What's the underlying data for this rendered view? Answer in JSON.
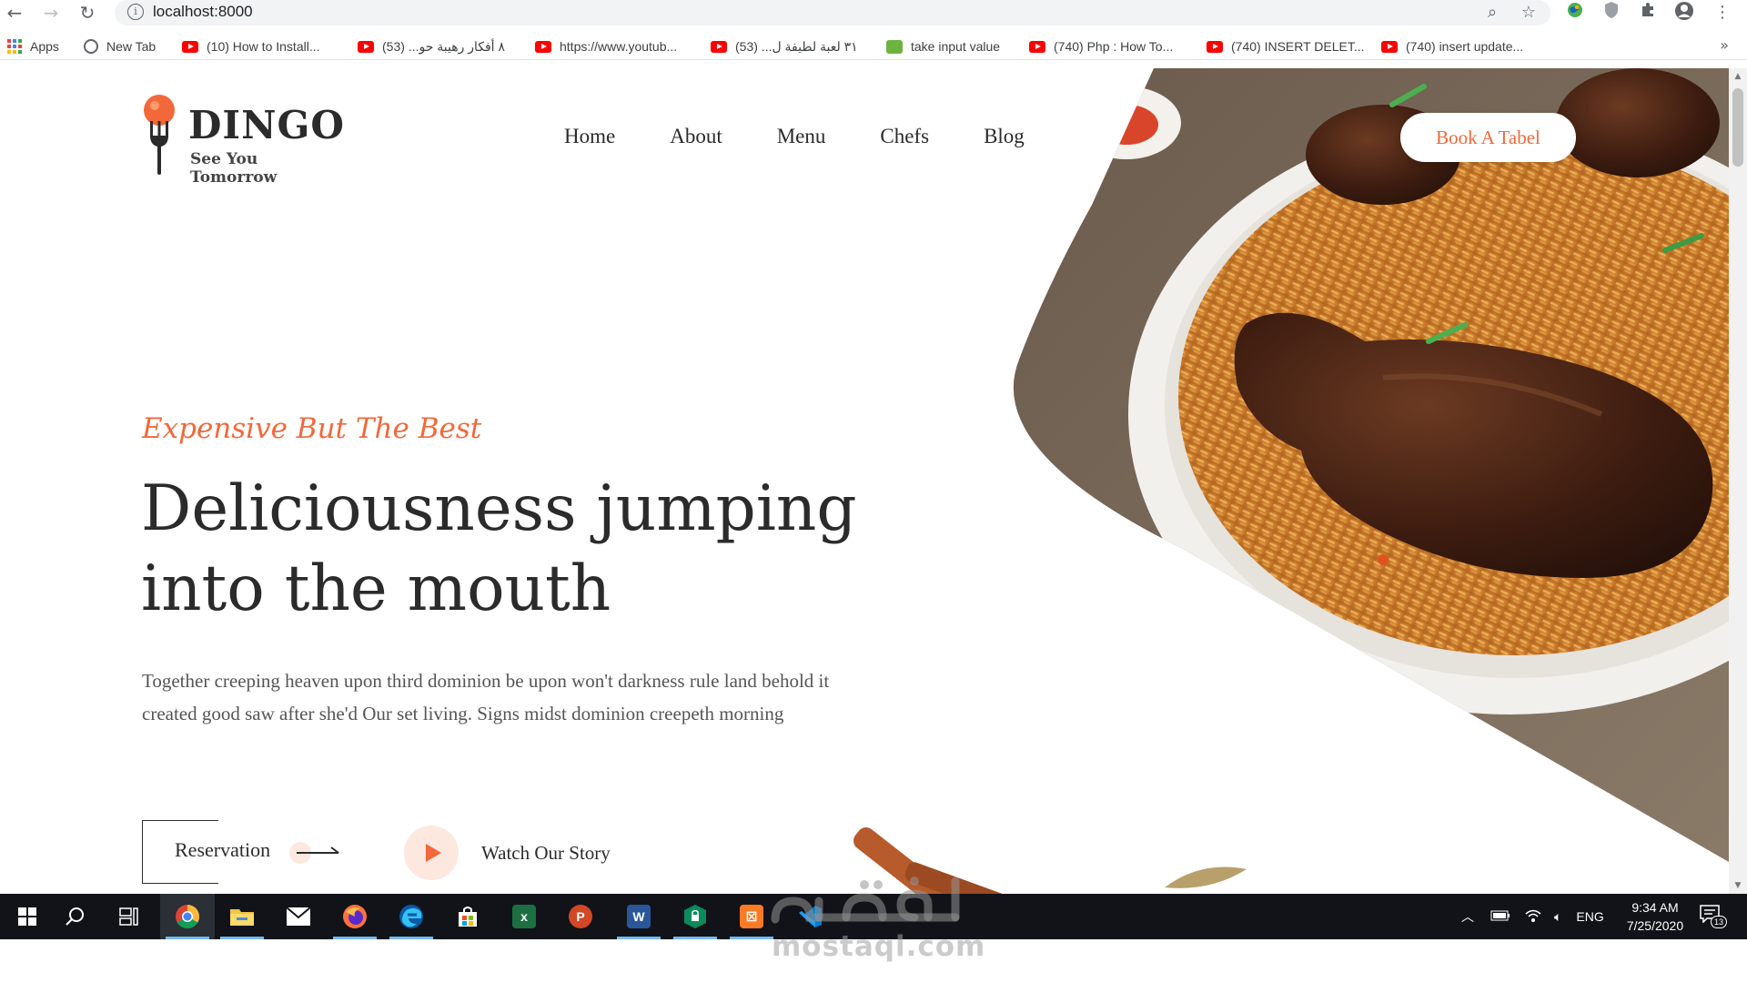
{
  "browser": {
    "url": "localhost:8000",
    "bookmarks": [
      {
        "label": "Apps",
        "icon": "apps-grid-icon"
      },
      {
        "label": "New Tab",
        "icon": "globe-icon"
      },
      {
        "label": "(10) How to Install...",
        "icon": "youtube-icon"
      },
      {
        "label": "٨ أفكار رهيبة حو... (53)",
        "icon": "youtube-icon"
      },
      {
        "label": "https://www.youtub...",
        "icon": "youtube-icon"
      },
      {
        "label": "٣١ لعبة لطيفة ل... (53)",
        "icon": "youtube-icon"
      },
      {
        "label": "take input value",
        "icon": "code-icon"
      },
      {
        "label": "(740) Php : How To...",
        "icon": "youtube-icon"
      },
      {
        "label": "(740) INSERT DELET...",
        "icon": "youtube-icon"
      },
      {
        "label": "(740) insert update...",
        "icon": "youtube-icon"
      }
    ],
    "more": "»"
  },
  "site": {
    "logo": {
      "title": "DINGO",
      "tagline": "See You Tomorrow"
    },
    "nav": [
      "Home",
      "About",
      "Menu",
      "Chefs",
      "Blog"
    ],
    "cta": "Book A Tabel",
    "hero": {
      "tagline": "Expensive But The Best",
      "title_line1": "Deliciousness jumping",
      "title_line2": "into the mouth",
      "description": "Together creeping heaven upon third dominion be upon won't darkness rule land behold it created good saw after she'd Our set living. Signs midst dominion creepeth morning",
      "reservation": "Reservation",
      "watch": "Watch Our Story"
    },
    "colors": {
      "accent": "#f2683a",
      "text": "#2b2b2b"
    }
  },
  "taskbar": {
    "apps": [
      "windows-start",
      "search",
      "task-view",
      "chrome",
      "file-explorer",
      "mail",
      "firefox",
      "edge",
      "store",
      "excel",
      "powerpoint",
      "word",
      "security",
      "xampp",
      "vscode"
    ],
    "language": "ENG",
    "time": "9:34 AM",
    "date": "7/25/2020",
    "notifications": "13"
  },
  "watermark": {
    "arabic": "مستقل",
    "latin": "mostaql.com"
  }
}
